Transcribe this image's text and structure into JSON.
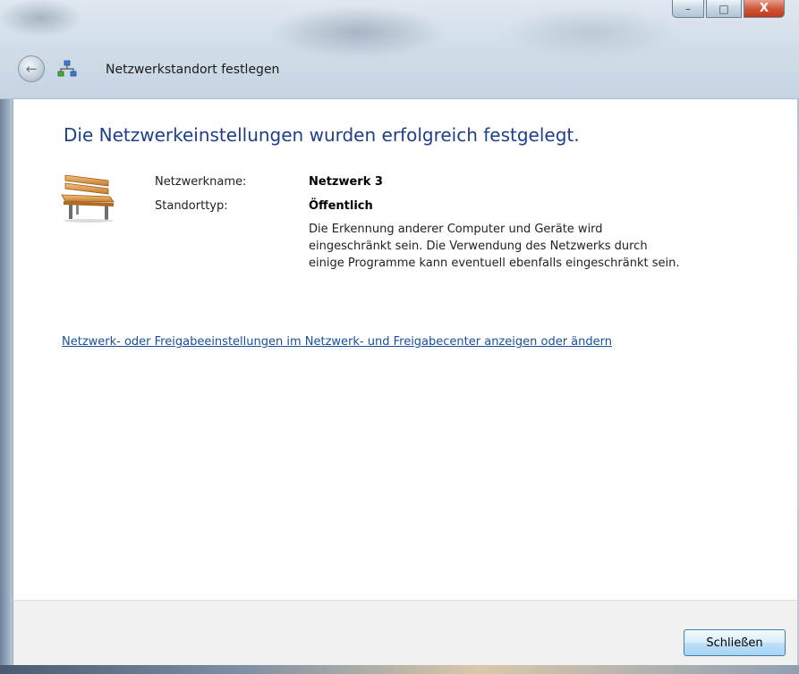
{
  "window": {
    "title": "Netzwerkstandort festlegen",
    "controls": {
      "minimize": "–",
      "maximize": "□",
      "close": "X"
    }
  },
  "nav": {
    "back_icon": "back-arrow-icon",
    "net_icon": "network-icon"
  },
  "main": {
    "heading": "Die Netzwerkeinstellungen wurden erfolgreich festgelegt.",
    "fields": {
      "name_label": "Netzwerkname:",
      "name_value": "Netzwerk 3",
      "type_label": "Standorttyp:",
      "type_value": "Öffentlich"
    },
    "description": "Die Erkennung anderer Computer und Geräte wird eingeschränkt sein. Die Verwendung des Netzwerks durch einige Programme kann eventuell ebenfalls eingeschränkt sein.",
    "link": "Netzwerk- oder Freigabeeinstellungen im Netzwerk- und Freigabecenter anzeigen oder ändern",
    "location_icon": "park-bench-icon"
  },
  "footer": {
    "close_label": "Schließen"
  },
  "colors": {
    "heading": "#1e3f8a",
    "link": "#1a4fa0",
    "button_border": "#3c7fb1"
  }
}
